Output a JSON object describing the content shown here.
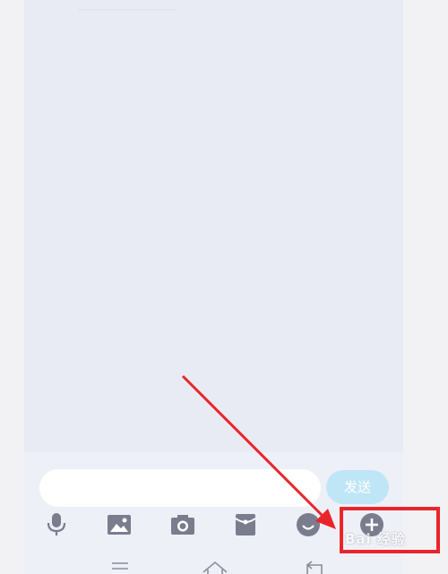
{
  "chat": {
    "input_placeholder": "",
    "send_label": "发送"
  },
  "toolbar": {
    "items": [
      {
        "name": "voice",
        "icon": "microphone-icon"
      },
      {
        "name": "photo",
        "icon": "image-icon"
      },
      {
        "name": "camera",
        "icon": "camera-icon"
      },
      {
        "name": "red-packet",
        "icon": "red-packet-icon"
      },
      {
        "name": "emoji",
        "icon": "emoji-icon"
      },
      {
        "name": "more",
        "icon": "plus-circle-icon"
      }
    ]
  },
  "navbar": {
    "items": [
      {
        "name": "menu",
        "icon": "menu-icon"
      },
      {
        "name": "home",
        "icon": "home-icon"
      },
      {
        "name": "back",
        "icon": "back-icon"
      }
    ]
  },
  "annotation": {
    "highlight_color": "#e8252b",
    "watermark": "Bai 经验"
  },
  "colors": {
    "background": "#e9ebf4",
    "send_button": "#bfe6f7",
    "icon": "#7a7d8e"
  }
}
